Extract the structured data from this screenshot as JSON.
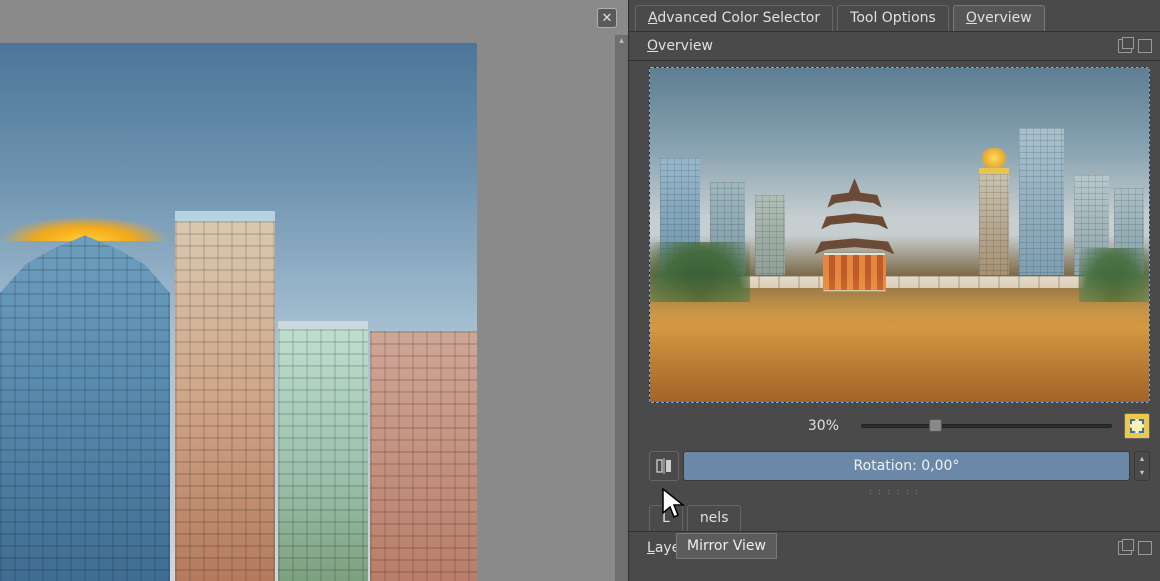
{
  "tabs": {
    "advanced_color_selector": "Advanced Color Selector",
    "tool_options": "Tool Options",
    "overview": "Overview"
  },
  "docker": {
    "overview_title": "Overview",
    "layers_title": "Layers"
  },
  "zoom": {
    "percent_label": "30%",
    "slider_value": 30
  },
  "rotation": {
    "label": "Rotation: 0,00°"
  },
  "lower_tabs": {
    "layers_partial": "L",
    "channels_partial": "nels"
  },
  "tooltip": {
    "mirror_view": "Mirror View"
  },
  "icons": {
    "close": "✕",
    "up": "▴",
    "down": "▾"
  }
}
